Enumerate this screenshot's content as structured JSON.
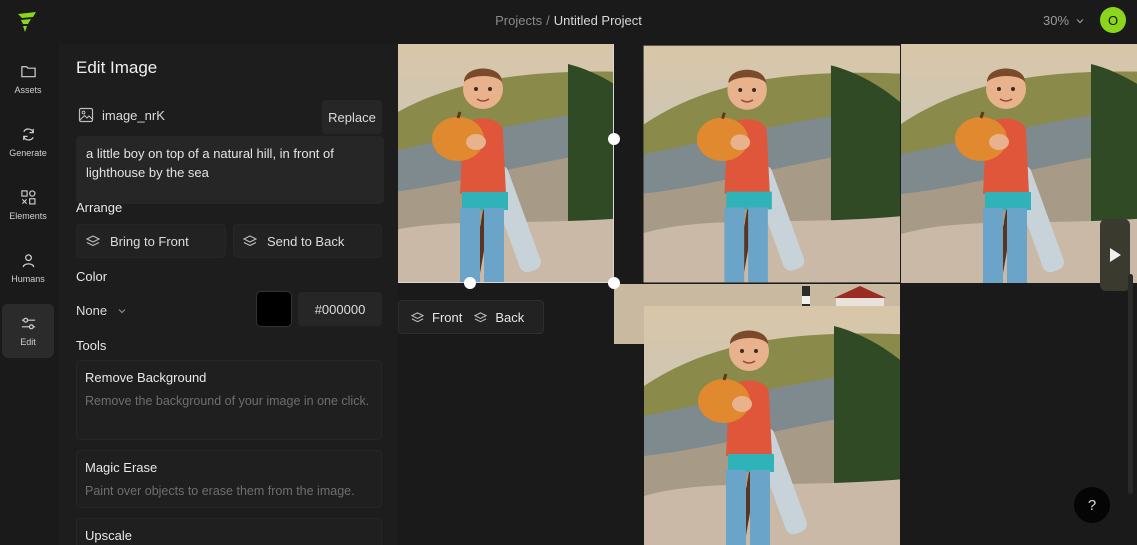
{
  "app": {
    "breadcrumb_root": "Projects",
    "breadcrumb_sep": "/",
    "project_name": "Untitled Project",
    "zoom": "30%",
    "avatar_initial": "O",
    "accent_color": "#8bd61c"
  },
  "rail": [
    {
      "label": "Assets",
      "icon": "folder-icon"
    },
    {
      "label": "Generate",
      "icon": "refresh-icon"
    },
    {
      "label": "Elements",
      "icon": "shapes-icon"
    },
    {
      "label": "Humans",
      "icon": "person-icon"
    },
    {
      "label": "Edit",
      "icon": "sliders-icon"
    }
  ],
  "panel": {
    "title": "Edit Image",
    "image_name": "image_nrK",
    "replace_label": "Replace",
    "prompt": "a little boy on top of a natural hill, in front of lighthouse by the sea",
    "arrange_label": "Arrange",
    "bring_to_front": "Bring to Front",
    "send_to_back": "Send to Back",
    "color_label": "Color",
    "color_value": "None",
    "color_hex": "#000000",
    "tools_label": "Tools",
    "tools": [
      {
        "title": "Remove Background",
        "desc": "Remove the background of your image in one click."
      },
      {
        "title": "Magic Erase",
        "desc": "Paint over objects to erase them from the image."
      },
      {
        "title": "Upscale",
        "desc": ""
      }
    ]
  },
  "canvas": {
    "front_label": "Front",
    "back_label": "Back",
    "help_label": "?"
  }
}
